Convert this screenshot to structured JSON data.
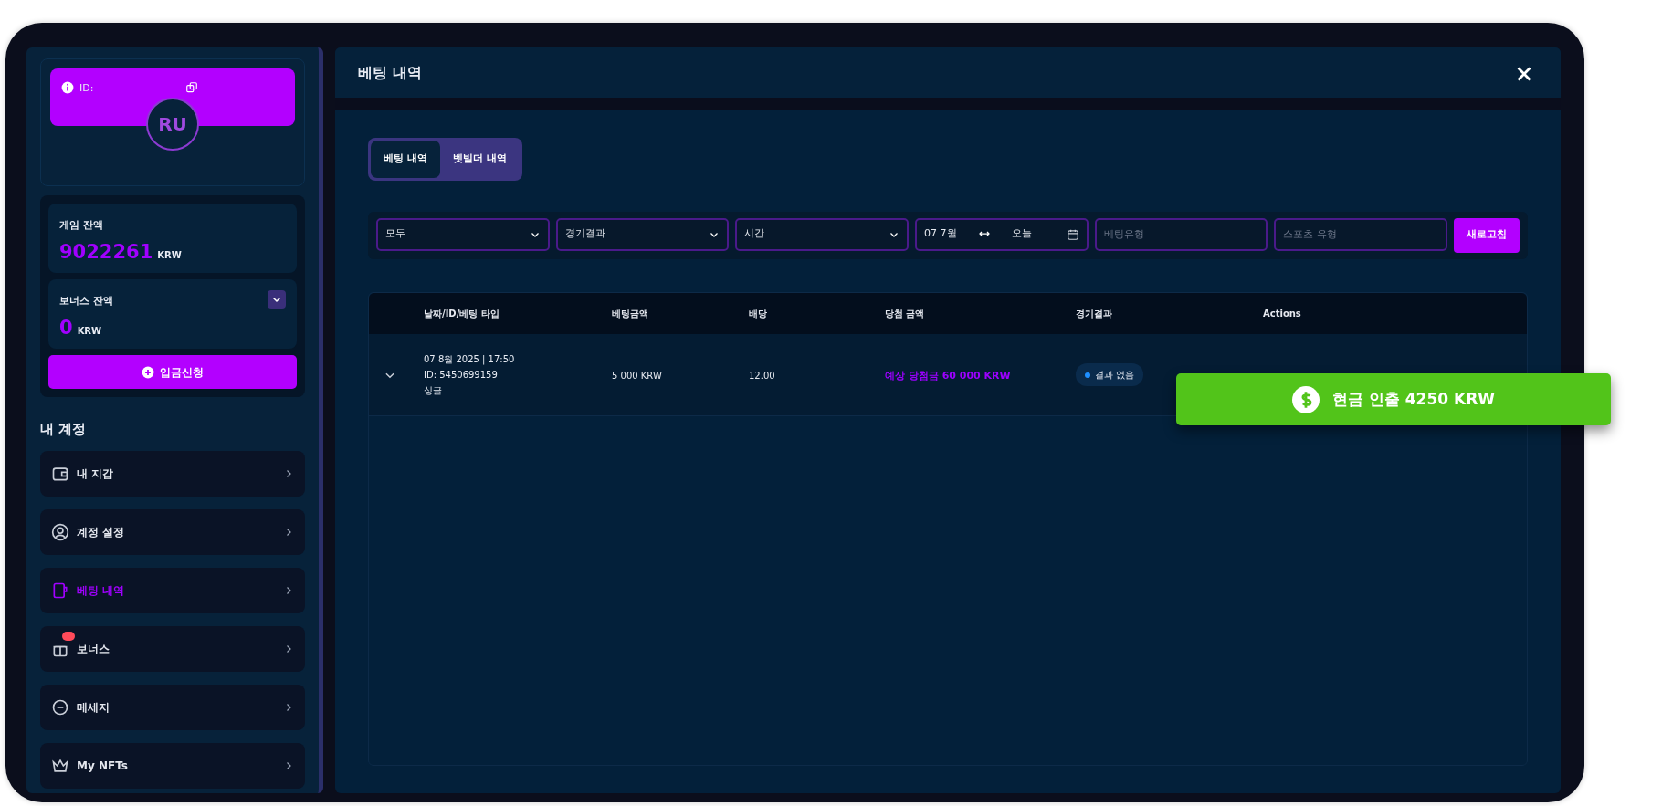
{
  "sidebar": {
    "profile": {
      "id_label": "ID:",
      "initials": "RU"
    },
    "balances": [
      {
        "label": "게임 잔액",
        "amount": "9022261",
        "currency": "KRW",
        "expandable": false
      },
      {
        "label": "보너스 잔액",
        "amount": "0",
        "currency": "KRW",
        "expandable": true
      }
    ],
    "deposit_button": "입금신청",
    "section_title": "내 계정",
    "items": [
      {
        "label": "내 지갑",
        "selected": false,
        "badge": false
      },
      {
        "label": "계정 설정",
        "selected": false,
        "badge": false
      },
      {
        "label": "베팅 내역",
        "selected": true,
        "badge": false
      },
      {
        "label": "보너스",
        "selected": false,
        "badge": true
      },
      {
        "label": "메세지",
        "selected": false,
        "badge": false
      },
      {
        "label": "My NFTs",
        "selected": false,
        "badge": false
      }
    ]
  },
  "modal": {
    "title": "베팅 내역",
    "tabs": [
      {
        "label": "베팅 내역",
        "selected": true
      },
      {
        "label": "벳빌더 내역",
        "selected": false
      }
    ],
    "filters": [
      {
        "kind": "select",
        "value": "모두"
      },
      {
        "kind": "select",
        "value": "경기결과"
      },
      {
        "kind": "select",
        "value": "시간"
      },
      {
        "kind": "date_range",
        "from": "07 7월",
        "to": "오늘"
      },
      {
        "kind": "input",
        "placeholder": "베팅유형"
      },
      {
        "kind": "input",
        "placeholder": "스포츠 유형"
      }
    ],
    "refresh_button": "새로고침",
    "table": {
      "columns": [
        "날짜/ID/베팅 타입",
        "베팅금액",
        "배당",
        "당첨 금액",
        "경기결과",
        "Actions"
      ],
      "rows": [
        {
          "expanded": false,
          "date": "07 8월 2025 | 17:50",
          "id": "ID: 5450699159",
          "type": "싱글",
          "stake": "5 000 KRW",
          "odds": "12.00",
          "payout": "예상 당첨금 60 000 KRW",
          "result": "결과 없음"
        }
      ]
    }
  },
  "withdraw_button": "현금 인출 4250 KRW"
}
